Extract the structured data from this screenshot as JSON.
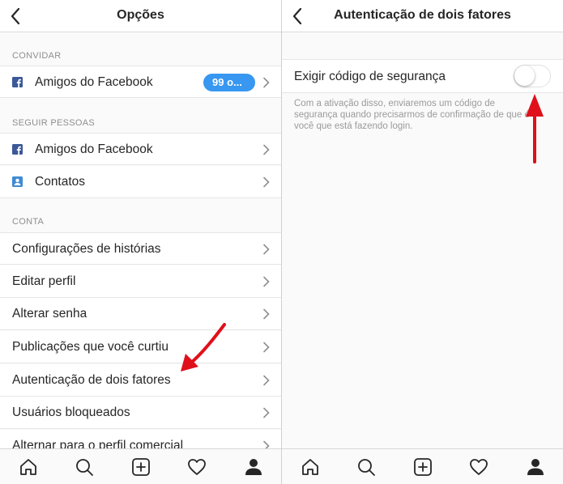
{
  "left": {
    "title": "Opções",
    "sections": {
      "invite": "CONVIDAR",
      "follow": "SEGUIR PESSOAS",
      "account": "CONTA"
    },
    "invite_item": {
      "label": "Amigos do Facebook",
      "badge": "99 o..."
    },
    "follow_items": [
      {
        "label": "Amigos do Facebook",
        "icon": "facebook-icon"
      },
      {
        "label": "Contatos",
        "icon": "contacts-icon"
      }
    ],
    "account_items": [
      "Configurações de histórias",
      "Editar perfil",
      "Alterar senha",
      "Publicações que você curtiu",
      "Autenticação de dois fatores",
      "Usuários bloqueados",
      "Alternar para o perfil comercial"
    ]
  },
  "right": {
    "title": "Autenticação de dois fatores",
    "toggle_label": "Exigir código de segurança",
    "toggle_on": false,
    "description": "Com a ativação disso, enviaremos um código de segurança quando precisarmos de confirmação de que é você que está fazendo login."
  },
  "tabbar": [
    "home-icon",
    "search-icon",
    "new-post-icon",
    "activity-heart-icon",
    "profile-icon"
  ],
  "colors": {
    "accent": "#3897f0",
    "annotation_arrow": "#e0101b",
    "facebook": "#3b5998",
    "contacts": "#3f8bd3"
  }
}
